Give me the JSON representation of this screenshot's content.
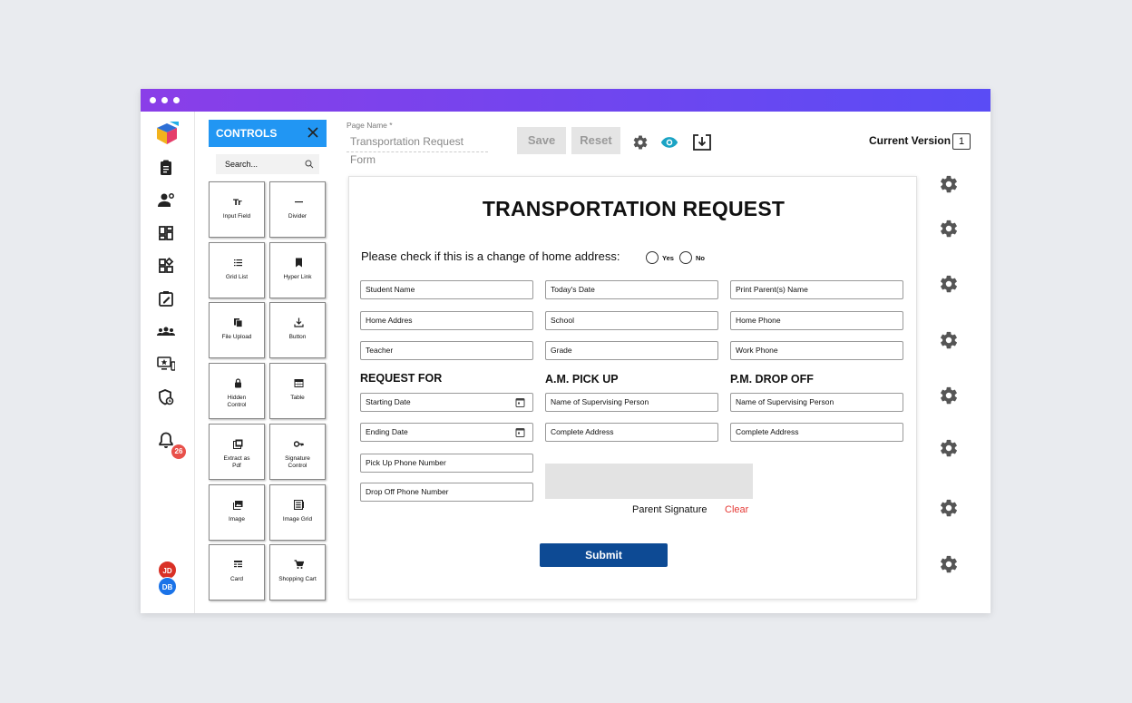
{
  "window": {
    "titlebar_gradient": [
      "#8a3ee8",
      "#5a4cf5"
    ]
  },
  "sidebar": {
    "icons": [
      "app-logo-icon",
      "clipboard-icon",
      "user-settings-icon",
      "dashboard-icon",
      "widgets-icon",
      "edit-note-icon",
      "groups-icon",
      "monitor-star-icon",
      "security-icon",
      "bell-icon"
    ],
    "notification_count": "26",
    "avatars": [
      {
        "initials": "JD",
        "color": "#d93025"
      },
      {
        "initials": "DB",
        "color": "#1a73e8"
      }
    ]
  },
  "controls_panel": {
    "title": "CONTROLS",
    "search_placeholder": "Search...",
    "items": [
      {
        "label": "Input Field",
        "icon": "text-field-icon"
      },
      {
        "label": "Divider",
        "icon": "divider-icon"
      },
      {
        "label": "Grid List",
        "icon": "grid-list-icon"
      },
      {
        "label": "Hyper Link",
        "icon": "bookmark-icon"
      },
      {
        "label": "File Upload",
        "icon": "file-copy-icon"
      },
      {
        "label": "Button",
        "icon": "download-icon"
      },
      {
        "label": "Hidden Control",
        "icon": "lock-icon"
      },
      {
        "label": "Table",
        "icon": "table-icon"
      },
      {
        "label": "Extract as Pdf",
        "icon": "pdf-icon"
      },
      {
        "label": "Signature Control",
        "icon": "key-icon"
      },
      {
        "label": "Image",
        "icon": "image-icon"
      },
      {
        "label": "Image Grid",
        "icon": "image-grid-icon"
      },
      {
        "label": "Card",
        "icon": "card-icon"
      },
      {
        "label": "Shopping Cart",
        "icon": "cart-icon"
      }
    ]
  },
  "toolbar": {
    "page_name_label": "Page Name *",
    "page_name_value": "Transportation Request Form",
    "save_label": "Save",
    "reset_label": "Reset",
    "current_version_label": "Current Version",
    "current_version_value": "1",
    "accent": "#1aa3c4"
  },
  "form": {
    "title": "TRANSPORTATION REQUEST",
    "question": "Please check if this is a change of home address:",
    "yes_label": "Yes",
    "no_label": "No",
    "fields_row1": [
      "Student Name",
      "Today's Date",
      "Print Parent(s) Name"
    ],
    "fields_row2": [
      "Home Addres",
      "School",
      "Home Phone"
    ],
    "fields_row3": [
      "Teacher",
      "Grade",
      "Work Phone"
    ],
    "section_request": "REQUEST FOR",
    "section_am": "A.M. PICK UP",
    "section_pm": "P.M. DROP OFF",
    "request_fields": [
      "Starting Date",
      "Ending Date",
      "Pick Up Phone Number",
      "Drop Off Phone Number"
    ],
    "am_fields": [
      "Name of Supervising Person",
      "Complete Address"
    ],
    "pm_fields": [
      "Name of Supervising Person",
      "Complete Address"
    ],
    "signature_label": "Parent Signature",
    "clear_label": "Clear",
    "submit_label": "Submit",
    "submit_color": "#0d4a94"
  }
}
